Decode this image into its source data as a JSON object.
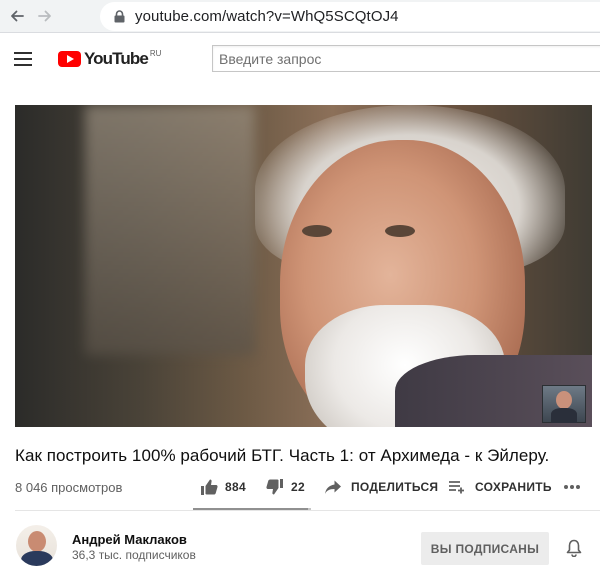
{
  "browser": {
    "url": "youtube.com/watch?v=WhQ5SCQtOJ4",
    "icons": [
      "back-arrow-icon",
      "forward-arrow-icon",
      "lock-icon"
    ]
  },
  "header": {
    "logo_text": "YouTube",
    "logo_region": "RU",
    "search_placeholder": "Введите запрос",
    "brand_color": "#ff0000"
  },
  "video": {
    "title": "Как построить 100% рабочий БТГ. Часть 1: от Архимеда - к Эйлеру.",
    "views": "8 046 просмотров",
    "likes": "884",
    "dislikes": "22",
    "like_ratio": 0.976,
    "share_label": "ПОДЕЛИТЬСЯ",
    "save_label": "СОХРАНИТЬ"
  },
  "channel": {
    "name": "Андрей Маклаков",
    "subscribers": "36,3 тыс. подписчиков",
    "subscribed_label": "ВЫ ПОДПИСАНЫ"
  }
}
